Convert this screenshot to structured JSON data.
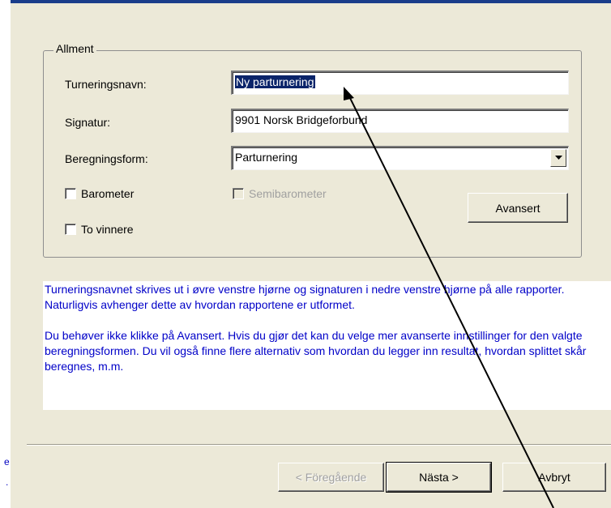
{
  "group": {
    "legend": "Allment"
  },
  "form": {
    "tournament_name_label": "Turneringsnavn:",
    "tournament_name_value": "Ny parturnering",
    "signature_label": "Signatur:",
    "signature_value": "9901 Norsk Bridgeforbund",
    "calc_form_label": "Beregningsform:",
    "calc_form_value": "Parturnering"
  },
  "checkboxes": {
    "barometer": {
      "label": "Barometer",
      "checked": false
    },
    "semibarometer": {
      "label": "Semibarometer",
      "checked": false,
      "enabled": false
    },
    "two_winners": {
      "label": "To vinnere",
      "checked": false
    }
  },
  "buttons": {
    "advanced": "Avansert",
    "previous": "< Föregående",
    "next": "Nästa >",
    "cancel": "Avbryt"
  },
  "info": {
    "paragraph1": "Turneringsnavnet skrives ut i øvre venstre hjørne og signaturen i nedre venstre hjørne på alle rapporter. Naturligvis avhenger dette av hvordan rapportene er utformet.",
    "paragraph2": "Du behøver ikke klikke på Avansert. Hvis du gjør det kan du velge mer avanserte innstillinger for den valgte beregningsformen. Du vil også finne flere alternativ som hvordan du legger inn resultat, hvordan splittet skår beregnes, m.m."
  },
  "stray_text": {
    "e": "e",
    "dot": "."
  },
  "colors": {
    "titlebar": "#1a3d8a",
    "selection": "#0a246a",
    "info_text": "#0000c8",
    "dialog_bg": "#ece9d8"
  },
  "icons": {
    "dropdown": "chevron-down-icon",
    "annotation": "arrow-annotation"
  }
}
